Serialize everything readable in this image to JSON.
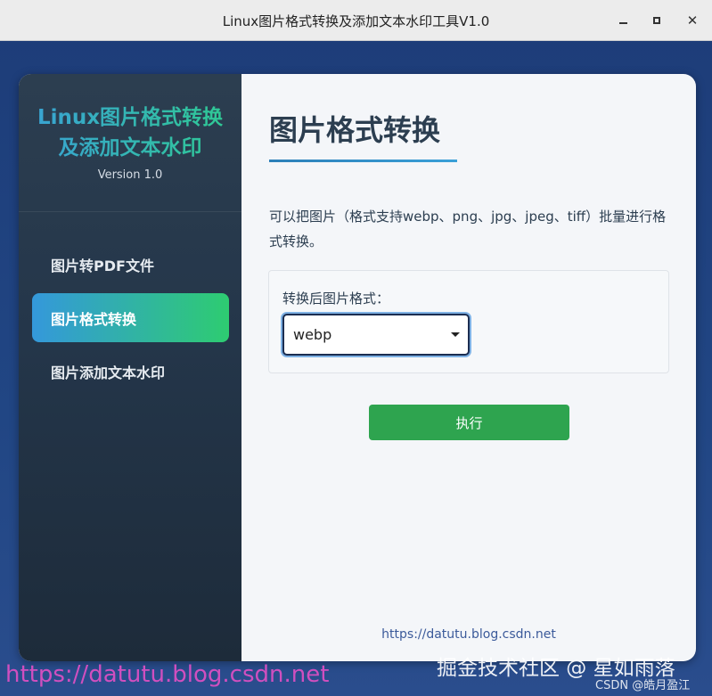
{
  "window": {
    "title": "Linux图片格式转换及添加文本水印工具V1.0",
    "controls": [
      "minimize-icon",
      "maximize-icon",
      "close-icon"
    ]
  },
  "sidebar": {
    "brand_line1": "Linux图片格式转换",
    "brand_line2": "及添加文本水印",
    "version": "Version 1.0",
    "items": [
      {
        "label": "图片转PDF文件",
        "active": false
      },
      {
        "label": "图片格式转换",
        "active": true
      },
      {
        "label": "图片添加文本水印",
        "active": false
      }
    ]
  },
  "main": {
    "title": "图片格式转换",
    "description": "可以把图片（格式支持webp、png、jpg、jpeg、tiff）批量进行格式转换。",
    "form": {
      "label": "转换后图片格式：",
      "selected": "webp"
    },
    "run_label": "执行",
    "footer_link": "https://datutu.blog.csdn.net"
  },
  "watermarks": {
    "url": "https://datutu.blog.csdn.net",
    "juejin": "掘金技术社区 @ 星如雨落",
    "csdn": "CSDN @皓月盈江"
  },
  "colors": {
    "sidebar_top": "#2c3e50",
    "accent_blue": "#3498db",
    "accent_green": "#2ecc71",
    "run_button": "#2ea44f",
    "title_text": "#2c3e50"
  }
}
